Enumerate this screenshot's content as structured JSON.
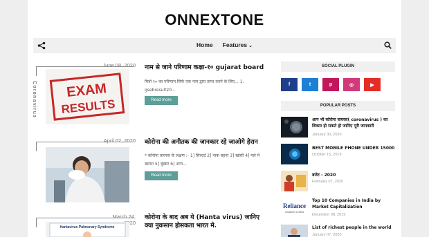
{
  "site": {
    "title": "ONNEXTONE"
  },
  "nav": {
    "items": [
      {
        "label": "Home"
      },
      {
        "label": "Features"
      }
    ],
    "share_icon": "share-icon",
    "search_icon": "search-icon"
  },
  "posts": [
    {
      "date": "June 08, 2020",
      "label": "Coronavirus",
      "title": "नाम से जाने परिणाम कक्षा-१० gujarat board",
      "snippet": "मित्रो १० का परिणाम सिर्फ एक नाम द्वारा प्राप्त करने के लिए... 1. gsebresult20...",
      "read_more": "Read more",
      "image_text_1": "EXAM",
      "image_text_2": "RESULTS"
    },
    {
      "date": "April 02, 2020",
      "title": "कोरोना की अनीतक की जानकार रहे जाओगे हेरान",
      "snippet": "* कोरोना वायरस के लक्षण :- 1] सिरदर्द 2] नाक बहना 3] खांसी 4] गले मे खराश 5] बुखार 6] अन्य...",
      "read_more": "Read more"
    },
    {
      "date": "March 24, 2020",
      "title": "कोरोना के बाद अब ये (Hanta virus) जानिए क्या नुकसान होसकता भारत मे.",
      "image_text_1": "Hantavirus Pulmonary Syndrome"
    }
  ],
  "sidebar": {
    "social_title": "SOCIAL PLUGIN",
    "popular_title": "POPULAR POSTS",
    "socials": [
      {
        "icon": "facebook-icon",
        "glyph": "f",
        "color": "#1f3f8c"
      },
      {
        "icon": "twitter-icon",
        "glyph": "t",
        "color": "#1d7fd6"
      },
      {
        "icon": "pinterest-icon",
        "glyph": "p",
        "color": "#c2185b"
      },
      {
        "icon": "instagram-icon",
        "glyph": "◎",
        "color": "#d0397a"
      },
      {
        "icon": "youtube-icon",
        "glyph": "▶",
        "color": "#e52d27"
      }
    ],
    "popular": [
      {
        "title": "आप भी कोरोना वायरस( coronavirus ) का शिकार हो सकते हो जानिए पूरी जानकारी",
        "date": "January 30, 2020"
      },
      {
        "title": "BEST MOBILE PHONE UNDER 15000",
        "date": "October 15, 2019"
      },
      {
        "title": "बजेट - 2020",
        "date": "February 07, 2020"
      },
      {
        "title": "Top 10 Companies in India by Market Capitalization",
        "date": "December 08, 2019"
      },
      {
        "title": "List of richest people in the world",
        "date": "January 07, 2020"
      }
    ],
    "reliance_text": "Reliance",
    "reliance_sub": "Industries Limited"
  }
}
